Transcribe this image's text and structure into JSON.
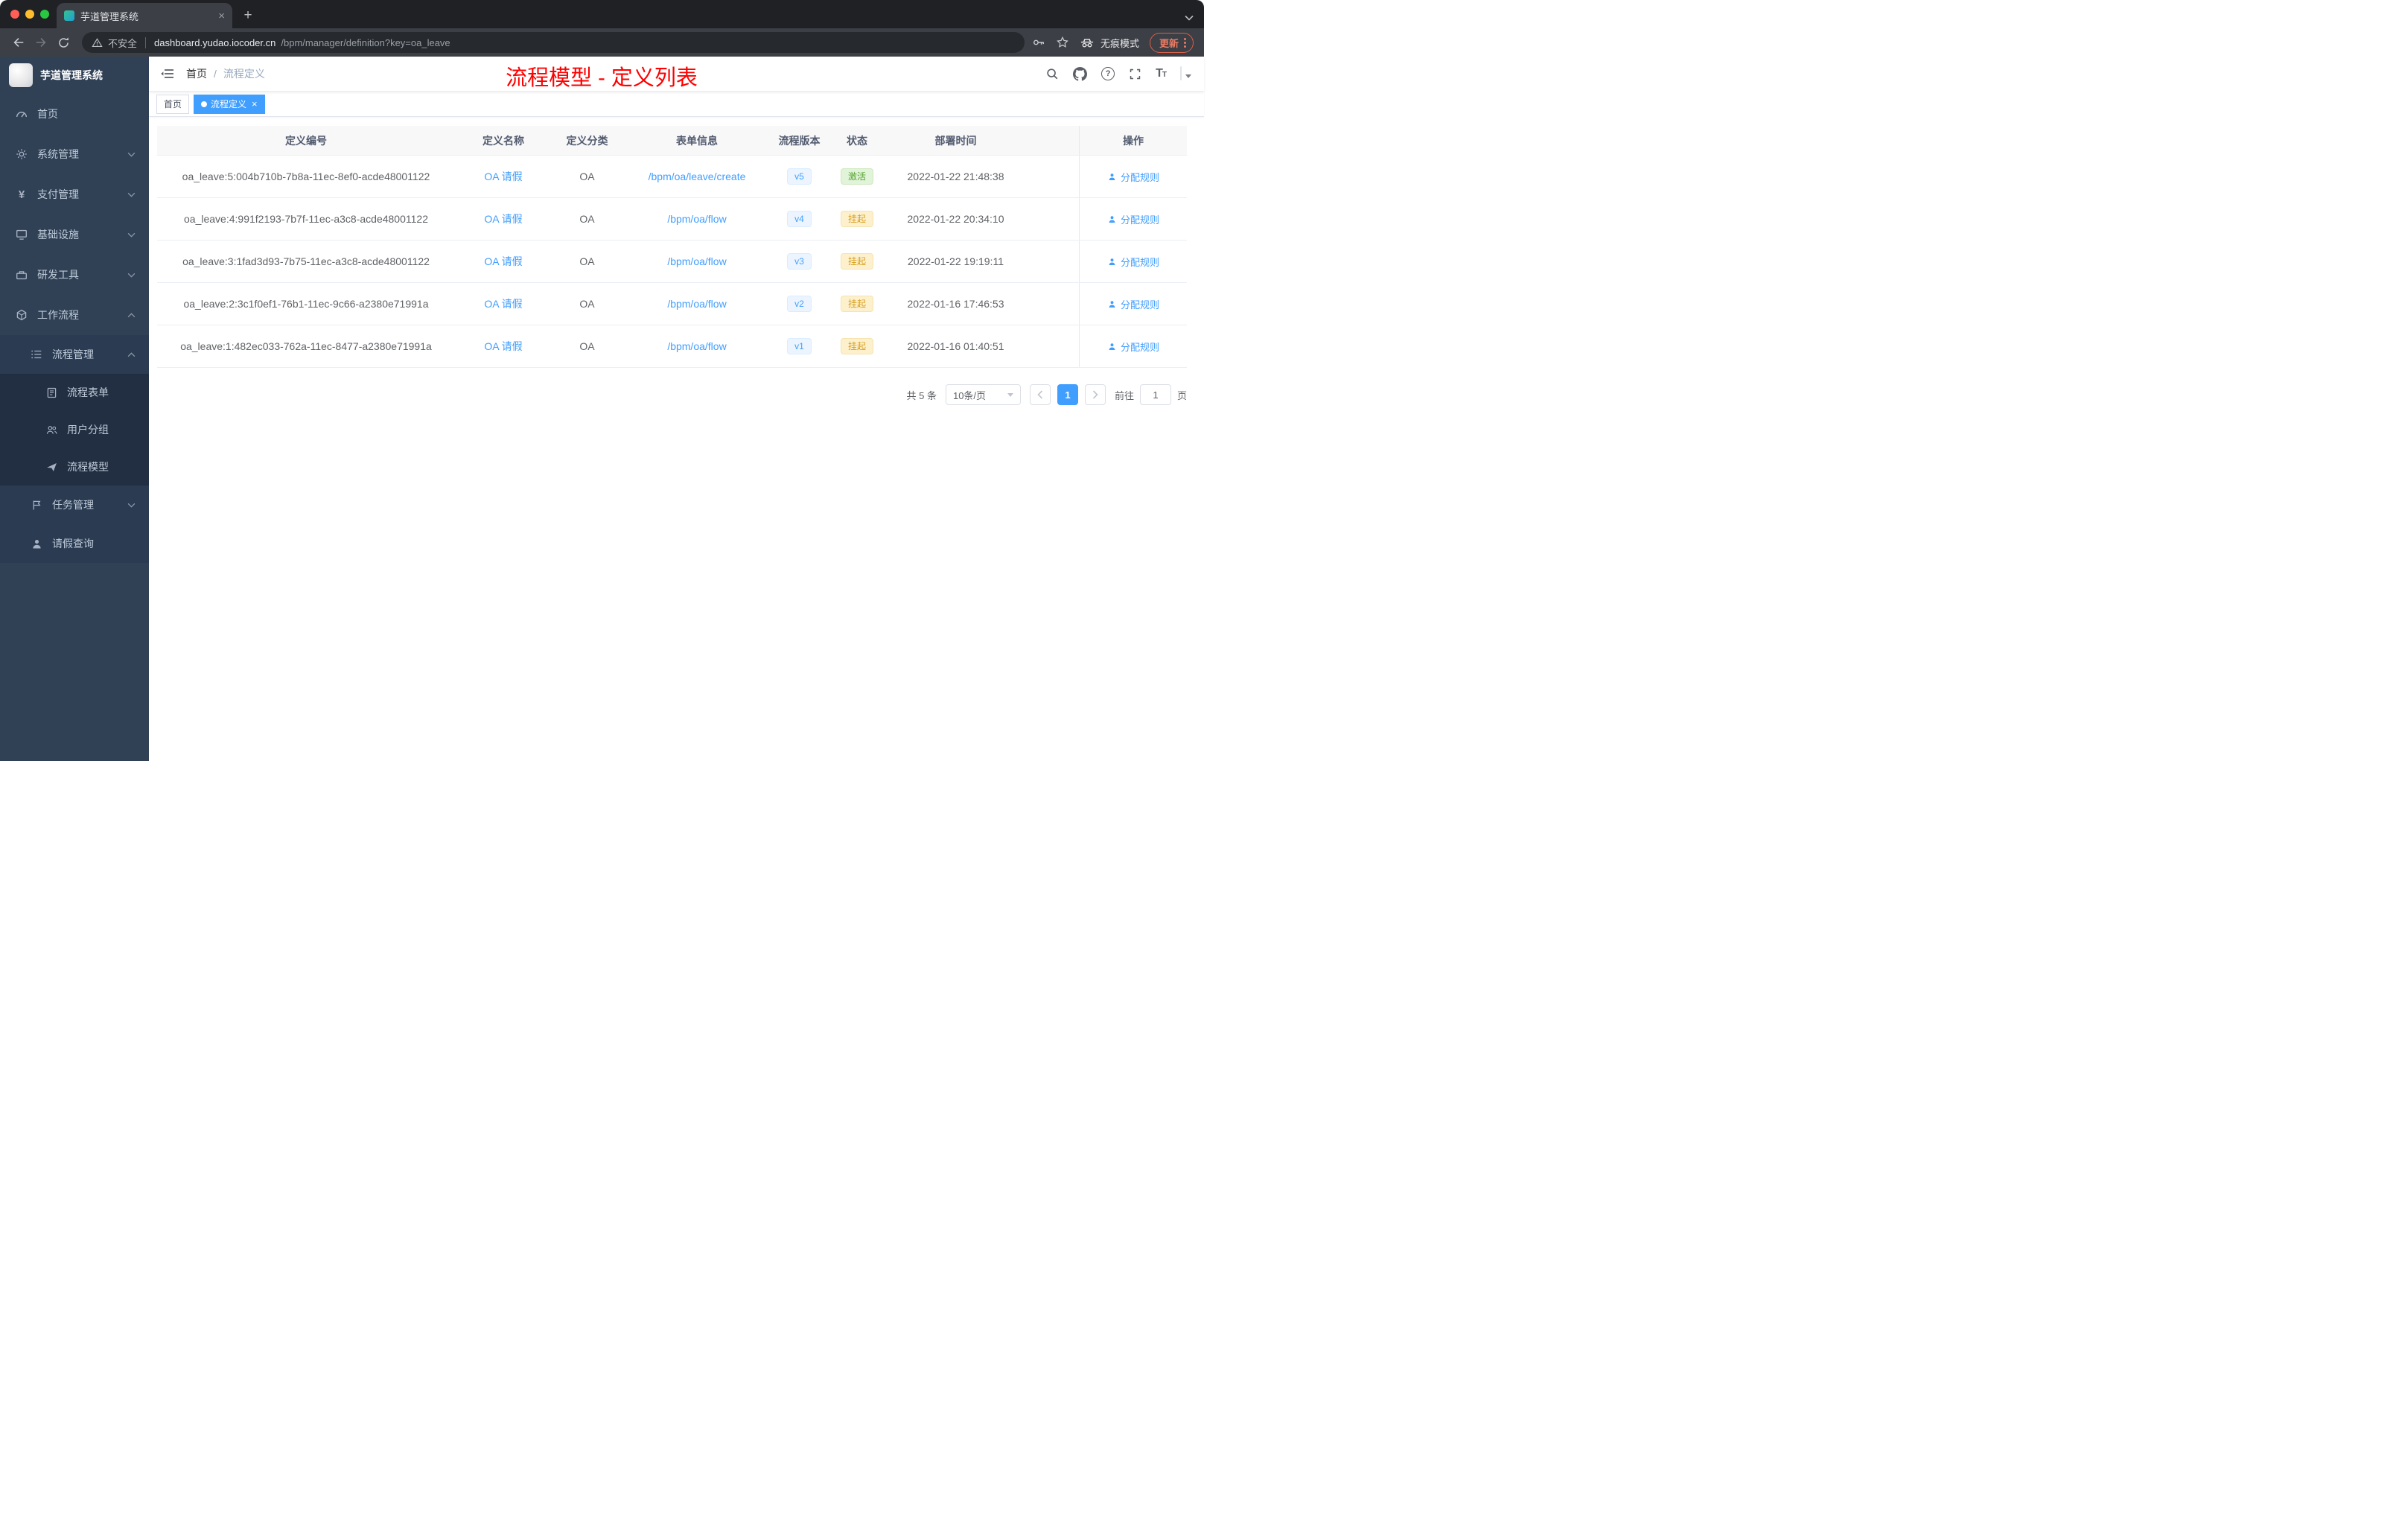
{
  "browser": {
    "tab_title": "芋道管理系统",
    "security_label": "不安全",
    "domain": "dashboard.yudao.iocoder.cn",
    "path": "/bpm/manager/definition?key=oa_leave",
    "incognito_label": "无痕模式",
    "update_label": "更新"
  },
  "sidebar": {
    "logo_title": "芋道管理系统",
    "items": [
      {
        "label": "首页"
      },
      {
        "label": "系统管理"
      },
      {
        "label": "支付管理"
      },
      {
        "label": "基础设施"
      },
      {
        "label": "研发工具"
      },
      {
        "label": "工作流程"
      },
      {
        "label": "流程管理"
      },
      {
        "label": "流程表单"
      },
      {
        "label": "用户分组"
      },
      {
        "label": "流程模型"
      },
      {
        "label": "任务管理"
      },
      {
        "label": "请假查询"
      }
    ]
  },
  "header": {
    "breadcrumb_home": "首页",
    "breadcrumb_current": "流程定义",
    "overlay_title": "流程模型 - 定义列表"
  },
  "tags": {
    "home_label": "首页",
    "active_label": "流程定义"
  },
  "table": {
    "columns": [
      "定义编号",
      "定义名称",
      "定义分类",
      "表单信息",
      "流程版本",
      "状态",
      "部署时间",
      "操作"
    ],
    "rows": [
      {
        "id": "oa_leave:5:004b710b-7b8a-11ec-8ef0-acde48001122",
        "name": "OA 请假",
        "category": "OA",
        "form": "/bpm/oa/leave/create",
        "version": "v5",
        "status": "激活",
        "status_type": "success",
        "deploy_time": "2022-01-22 21:48:38",
        "action": "分配规则"
      },
      {
        "id": "oa_leave:4:991f2193-7b7f-11ec-a3c8-acde48001122",
        "name": "OA 请假",
        "category": "OA",
        "form": "/bpm/oa/flow",
        "version": "v4",
        "status": "挂起",
        "status_type": "warning",
        "deploy_time": "2022-01-22 20:34:10",
        "action": "分配规则"
      },
      {
        "id": "oa_leave:3:1fad3d93-7b75-11ec-a3c8-acde48001122",
        "name": "OA 请假",
        "category": "OA",
        "form": "/bpm/oa/flow",
        "version": "v3",
        "status": "挂起",
        "status_type": "warning",
        "deploy_time": "2022-01-22 19:19:11",
        "action": "分配规则"
      },
      {
        "id": "oa_leave:2:3c1f0ef1-76b1-11ec-9c66-a2380e71991a",
        "name": "OA 请假",
        "category": "OA",
        "form": "/bpm/oa/flow",
        "version": "v2",
        "status": "挂起",
        "status_type": "warning",
        "deploy_time": "2022-01-16 17:46:53",
        "action": "分配规则"
      },
      {
        "id": "oa_leave:1:482ec033-762a-11ec-8477-a2380e71991a",
        "name": "OA 请假",
        "category": "OA",
        "form": "/bpm/oa/flow",
        "version": "v1",
        "status": "挂起",
        "status_type": "warning",
        "deploy_time": "2022-01-16 01:40:51",
        "action": "分配规则"
      }
    ]
  },
  "pagination": {
    "total": "共 5 条",
    "page_size": "10条/页",
    "current_page": "1",
    "goto_prefix": "前往",
    "goto_value": "1",
    "goto_suffix": "页"
  },
  "colors": {
    "accent": "#409eff",
    "overlay_title_red": "#fe0000",
    "sidebar_bg": "#304156",
    "status_active": "#67c23a",
    "status_suspended": "#e6a23c"
  }
}
